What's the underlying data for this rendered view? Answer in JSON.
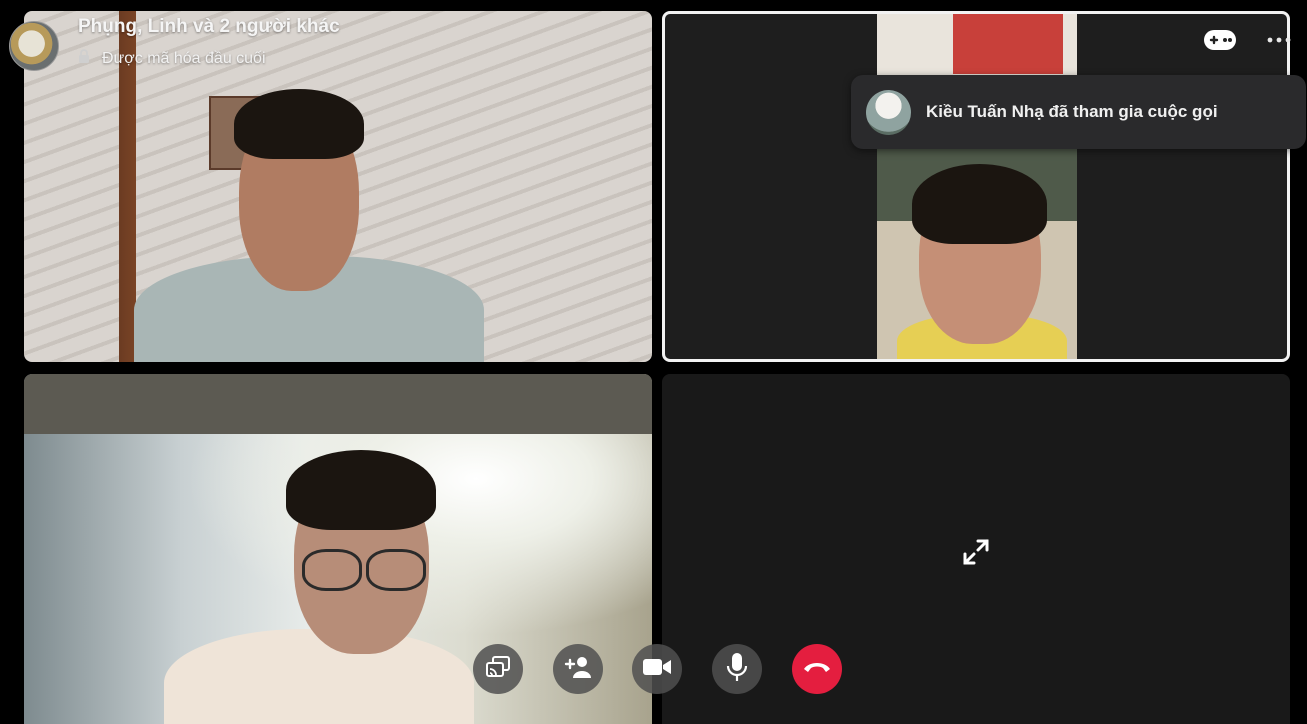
{
  "header": {
    "title": "Phụng, Linh và 2 người khác",
    "subtitle": "Được mã hóa đầu cuối"
  },
  "notification": {
    "text": "Kiều Tuấn Nhạ đã tham gia cuộc gọi"
  },
  "icons": {
    "lock": "lock-icon",
    "games": "gamepad-icon",
    "more": "more-dots-icon",
    "expand": "expand-arrows-icon"
  },
  "controls": [
    {
      "name": "share-screen",
      "icon": "screen-share-icon"
    },
    {
      "name": "add-people",
      "icon": "add-person-icon"
    },
    {
      "name": "video",
      "icon": "video-camera-icon"
    },
    {
      "name": "microphone",
      "icon": "microphone-icon"
    },
    {
      "name": "end-call",
      "icon": "hang-up-icon",
      "color": "#e41e3f"
    }
  ]
}
